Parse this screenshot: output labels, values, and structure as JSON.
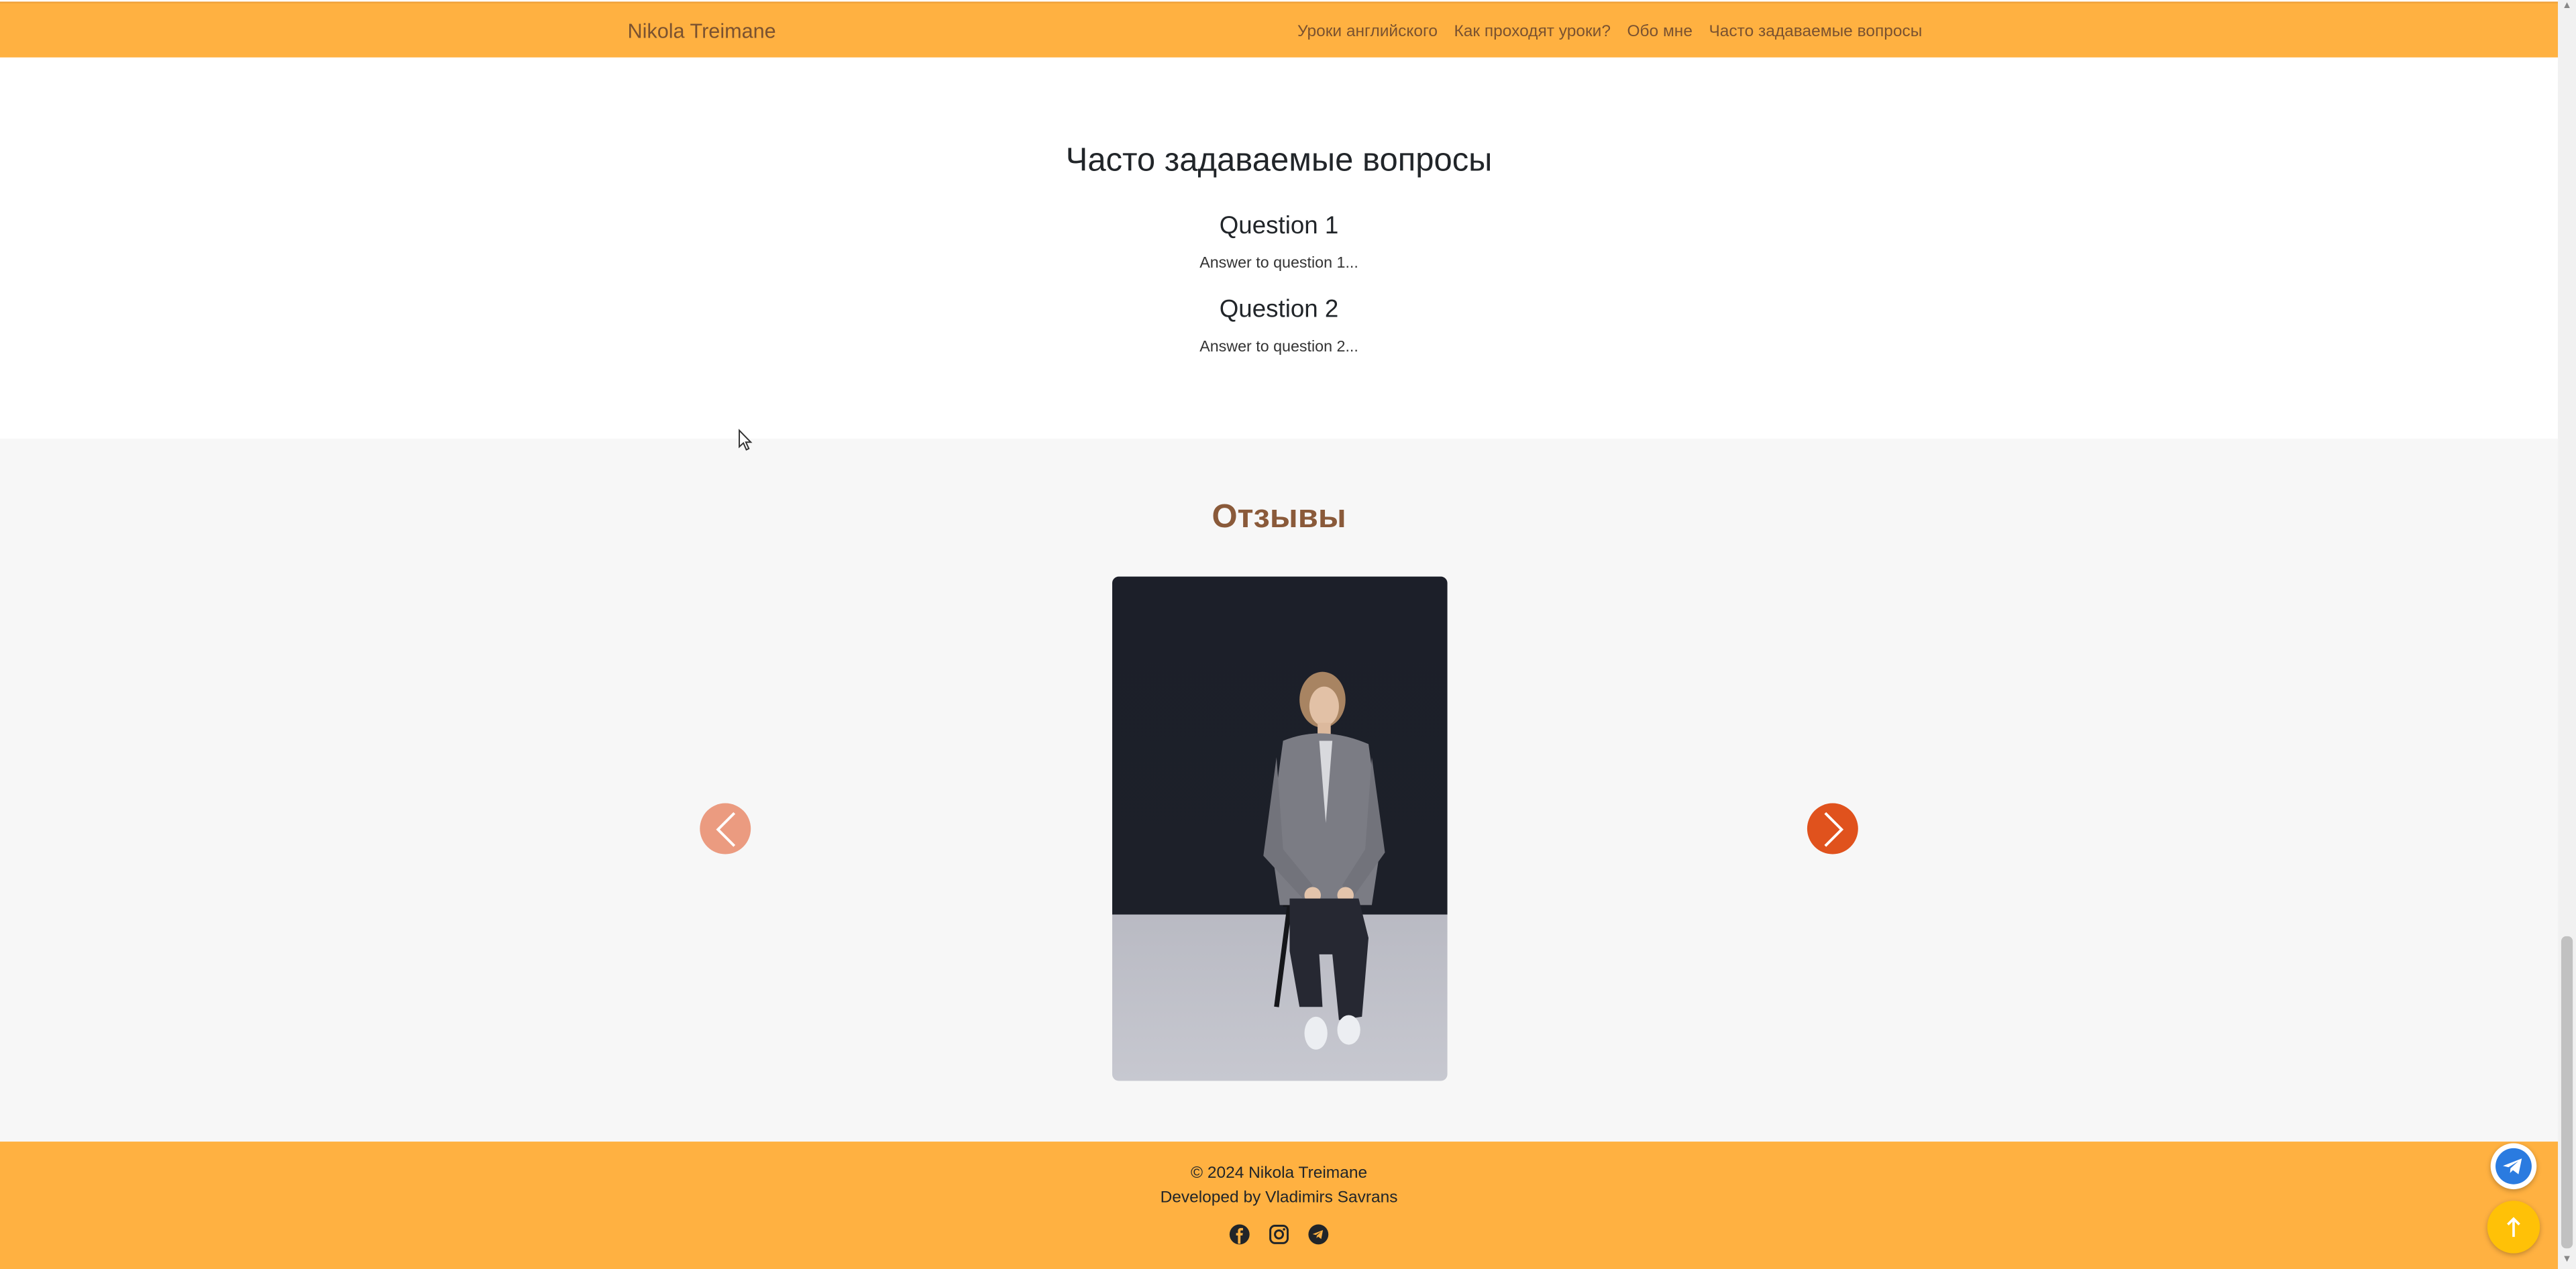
{
  "navbar": {
    "brand": "Nikola Treimane",
    "links": [
      "Уроки английского",
      "Как проходят уроки?",
      "Обо мне",
      "Часто задаваемые вопросы"
    ]
  },
  "faq": {
    "title": "Часто задаваемые вопросы",
    "items": [
      {
        "question": "Question 1",
        "answer": "Answer to question 1..."
      },
      {
        "question": "Question 2",
        "answer": "Answer to question 2..."
      }
    ]
  },
  "reviews": {
    "title": "Отзывы"
  },
  "footer": {
    "copyright": "© 2024 Nikola Treimane",
    "developer": "Developed by Vladimirs Savrans",
    "socials": [
      "facebook-icon",
      "instagram-icon",
      "telegram-icon"
    ]
  },
  "colors": {
    "navbar": "#ffb141",
    "footer": "#ffb141",
    "carousel_prev": "#eb9b80",
    "carousel_next": "#e0521d",
    "scroll_top": "#ffc107",
    "telegram": "#2a9fd6"
  }
}
